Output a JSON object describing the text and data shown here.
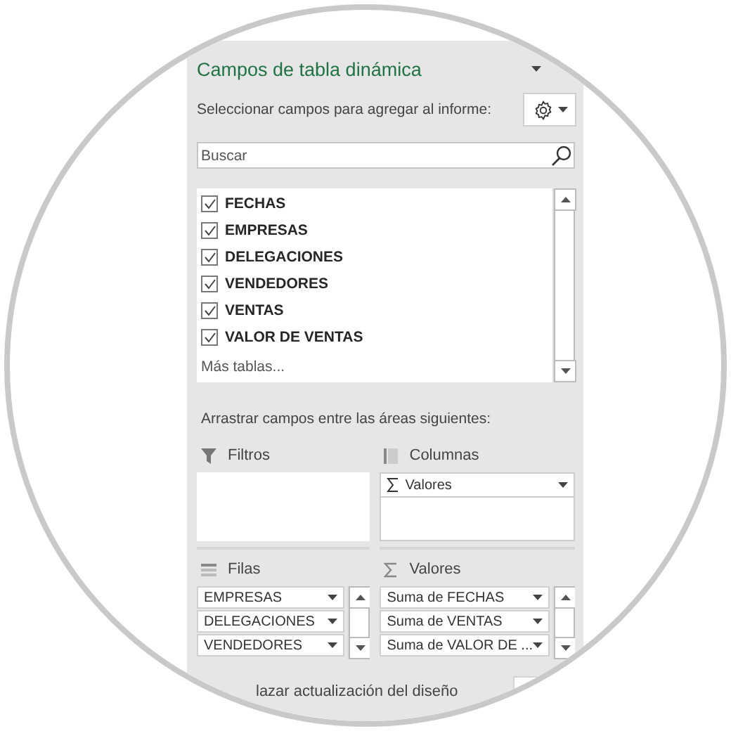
{
  "panel": {
    "title": "Campos de tabla dinámica"
  },
  "choose_label": "Seleccionar campos para agregar al informe:",
  "search": {
    "placeholder": "Buscar"
  },
  "fields": [
    {
      "label": "FECHAS",
      "checked": true
    },
    {
      "label": "EMPRESAS",
      "checked": true
    },
    {
      "label": "DELEGACIONES",
      "checked": true
    },
    {
      "label": "VENDEDORES",
      "checked": true
    },
    {
      "label": "VENTAS",
      "checked": true
    },
    {
      "label": "VALOR DE VENTAS",
      "checked": true
    }
  ],
  "more_tables": "Más tablas...",
  "drag_label": "Arrastrar campos entre las áreas siguientes:",
  "areas": [
    {
      "kind": "filters",
      "title": "Filtros"
    },
    {
      "kind": "columns",
      "title": "Columnas",
      "items": [
        {
          "label": "Valores",
          "sigma": true
        }
      ]
    },
    {
      "kind": "rows",
      "title": "Filas",
      "scrollable": true,
      "items": [
        {
          "label": "EMPRESAS"
        },
        {
          "label": "DELEGACIONES"
        },
        {
          "label": "VENDEDORES"
        }
      ]
    },
    {
      "kind": "values",
      "title": "Valores",
      "scrollable": true,
      "items": [
        {
          "label": "Suma de FECHAS"
        },
        {
          "label": "Suma de VENTAS"
        },
        {
          "label": "Suma de VALOR DE ..."
        }
      ]
    }
  ],
  "defer_label": "lazar actualización del diseño"
}
